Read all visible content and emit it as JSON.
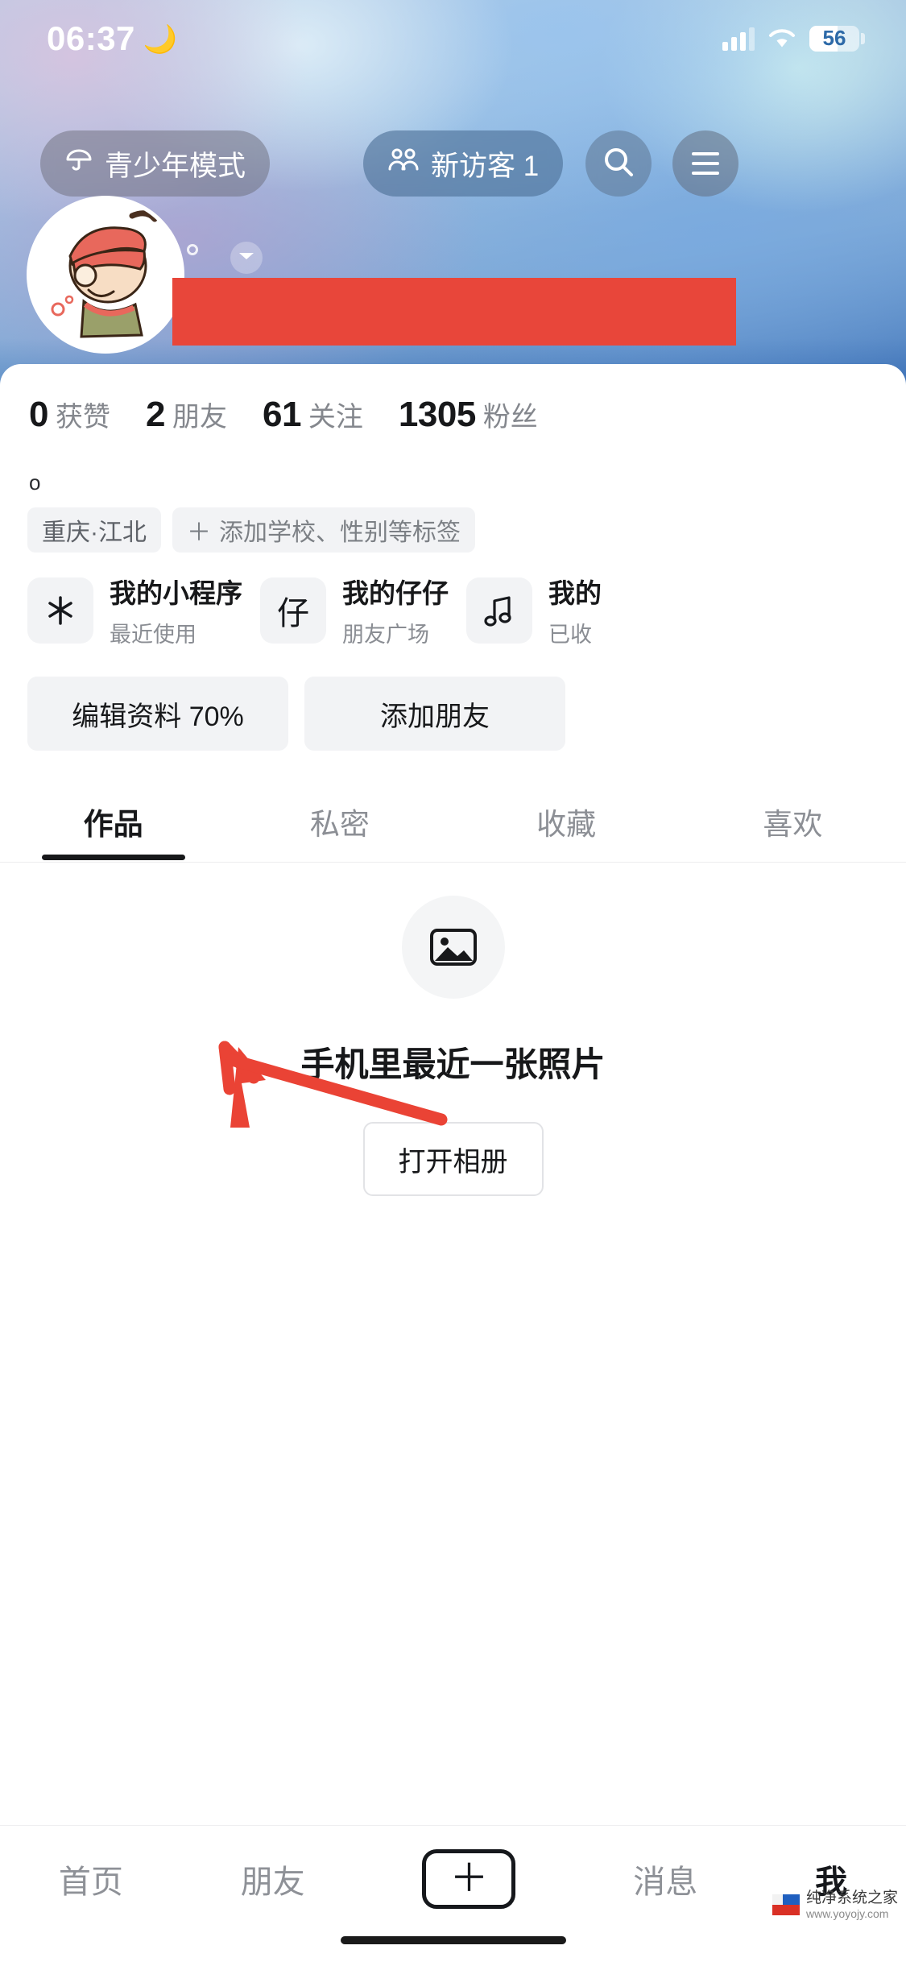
{
  "status_bar": {
    "time": "06:37",
    "moon_icon": "crescent-moon",
    "signal_icon": "cellular-signal",
    "wifi_icon": "wifi",
    "battery_level": "56"
  },
  "top_nav": {
    "teen_mode": {
      "label": "青少年模式",
      "icon": "umbrella-icon"
    },
    "visitor": {
      "label": "新访客 1",
      "icon": "people-icon"
    },
    "search": {
      "icon": "search-icon"
    },
    "menu": {
      "icon": "hamburger-menu-icon"
    }
  },
  "profile": {
    "avatar_alt": "user-avatar",
    "dropdown_icon": "chevron-down-icon",
    "bio": "o"
  },
  "stats": [
    {
      "num": "0",
      "label": "获赞"
    },
    {
      "num": "2",
      "label": "朋友"
    },
    {
      "num": "61",
      "label": "关注"
    },
    {
      "num": "1305",
      "label": "粉丝"
    }
  ],
  "tags": [
    {
      "label": "重庆·江北",
      "plus": ""
    },
    {
      "label": "添加学校、性别等标签",
      "plus": "＋"
    }
  ],
  "cards": [
    {
      "icon": "asterisk-icon",
      "icon_glyph": "✳",
      "title": "我的小程序",
      "sub": "最近使用"
    },
    {
      "icon": "zaizai-icon",
      "icon_glyph": "仔",
      "title": "我的仔仔",
      "sub": "朋友广场"
    },
    {
      "icon": "music-note-icon",
      "icon_glyph": "♫",
      "title": "我的",
      "sub": "已收"
    }
  ],
  "actions": {
    "edit_profile": "编辑资料 70%",
    "add_friend": "添加朋友"
  },
  "tabs": [
    {
      "label": "作品",
      "active": true
    },
    {
      "label": "私密",
      "active": false
    },
    {
      "label": "收藏",
      "active": false
    },
    {
      "label": "喜欢",
      "active": false
    }
  ],
  "empty_state": {
    "icon": "photo-placeholder-icon",
    "title": "手机里最近一张照片",
    "button": "打开相册"
  },
  "bottom_nav": [
    {
      "label": "首页",
      "active": false
    },
    {
      "label": "朋友",
      "active": false
    },
    {
      "label": "＋",
      "active": false,
      "is_plus": true
    },
    {
      "label": "消息",
      "active": false
    },
    {
      "label": "我",
      "active": true
    }
  ],
  "annotation": {
    "type": "red-arrow",
    "color": "#ea4335",
    "points_to": "编辑资料 70%"
  },
  "watermark": {
    "main": "纯净系统之家",
    "sub": "www.yoyojy.com"
  },
  "colors": {
    "accent_red": "#e8463a",
    "cover_blue": "#2b63ab",
    "chip_bg": "#f2f3f5",
    "text_primary": "#17181a",
    "text_secondary": "#8a8d93"
  }
}
